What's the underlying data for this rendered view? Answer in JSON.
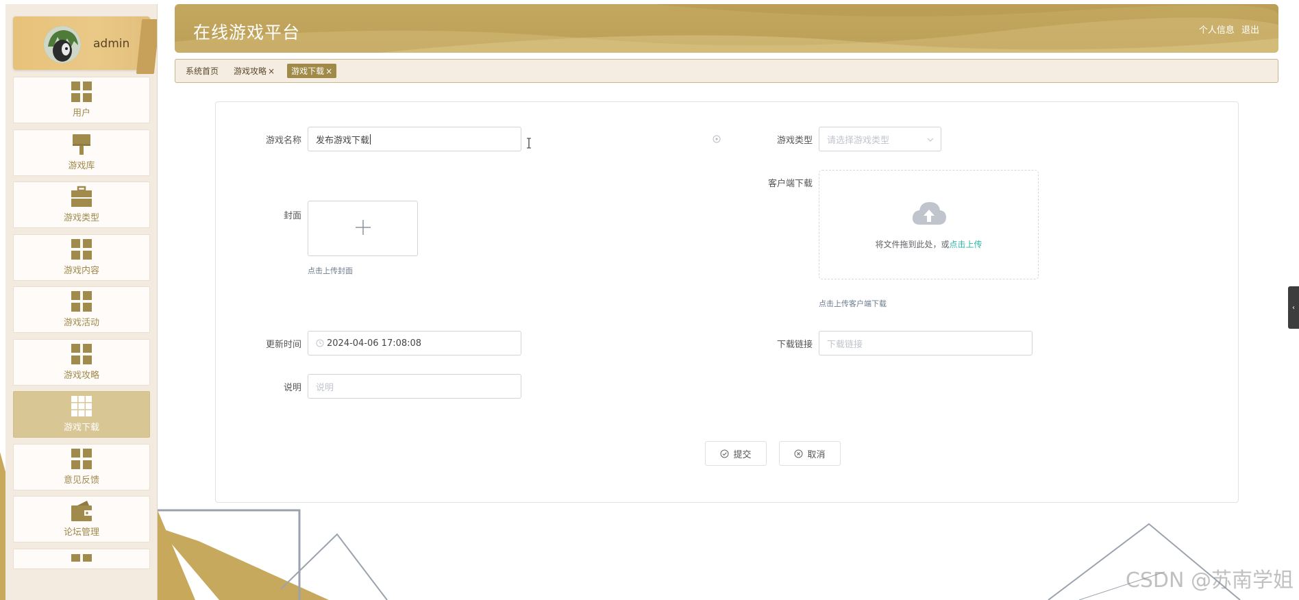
{
  "app": {
    "title": "在线游戏平台",
    "user_info_link": "个人信息",
    "logout_link": "退出"
  },
  "profile": {
    "name": "admin"
  },
  "sidebar": {
    "items": [
      {
        "label": "用户",
        "icon": "grid-icon"
      },
      {
        "label": "游戏库",
        "icon": "brush-icon"
      },
      {
        "label": "游戏类型",
        "icon": "briefcase-icon"
      },
      {
        "label": "游戏内容",
        "icon": "grid-icon"
      },
      {
        "label": "游戏活动",
        "icon": "grid-icon"
      },
      {
        "label": "游戏攻略",
        "icon": "grid-icon"
      },
      {
        "label": "游戏下载",
        "icon": "apps-icon",
        "active": true
      },
      {
        "label": "意见反馈",
        "icon": "grid-icon"
      },
      {
        "label": "论坛管理",
        "icon": "wallet-icon"
      }
    ]
  },
  "tabs": [
    {
      "label": "系统首页",
      "closable": false
    },
    {
      "label": "游戏攻略",
      "closable": true
    },
    {
      "label": "游戏下载",
      "closable": true,
      "active": true
    }
  ],
  "form": {
    "name_label": "游戏名称",
    "name_value": "发布游戏下载",
    "type_label": "游戏类型",
    "type_placeholder": "请选择游戏类型",
    "cover_label": "封面",
    "cover_hint": "点击上传封面",
    "client_label": "客户端下载",
    "dropzone_text": "将文件拖到此处，或",
    "dropzone_link": "点击上传",
    "client_hint": "点击上传客户端下载",
    "time_label": "更新时间",
    "time_value": "2024-04-06 17:08:08",
    "link_label": "下载链接",
    "link_placeholder": "下载链接",
    "desc_label": "说明",
    "desc_placeholder": "说明",
    "submit_label": "提交",
    "cancel_label": "取消"
  },
  "watermark": "CSDN @苏南学姐",
  "colors": {
    "accent": "#bca058",
    "sidebar_bg": "#f3ebe0",
    "active_item": "#d8c694",
    "icon_color": "#a08a4c",
    "upload_link": "#2bb6a6"
  }
}
